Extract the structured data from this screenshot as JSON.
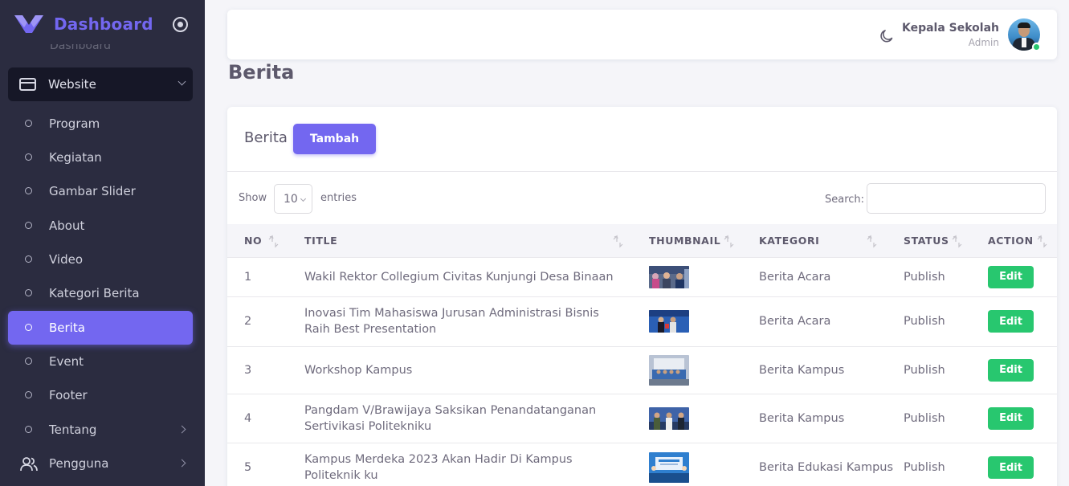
{
  "sidebar": {
    "brand": "Dashboard",
    "hidden_item": "Dashboard",
    "group": {
      "label": "Website"
    },
    "items": [
      {
        "label": "Program"
      },
      {
        "label": "Kegiatan"
      },
      {
        "label": "Gambar Slider"
      },
      {
        "label": "About"
      },
      {
        "label": "Video"
      },
      {
        "label": "Kategori Berita"
      },
      {
        "label": "Berita",
        "active": true
      },
      {
        "label": "Event"
      },
      {
        "label": "Footer"
      },
      {
        "label": "Tentang"
      },
      {
        "label": "Pengguna"
      }
    ]
  },
  "navbar": {
    "user_name": "Kepala Sekolah",
    "user_role": "Admin"
  },
  "page": {
    "title": "Berita"
  },
  "card": {
    "title": "Berita",
    "add_button": "Tambah",
    "show_label": "Show",
    "page_length": "10",
    "entries_label": "entries",
    "search_label": "Search:"
  },
  "table": {
    "headers": {
      "no": "NO",
      "title": "TITLE",
      "thumbnail": "THUMBNAIL",
      "kategori": "KATEGORI",
      "status": "STATUS",
      "action": "ACTION"
    },
    "rows": [
      {
        "no": "1",
        "title": "Wakil Rektor Collegium Civitas Kunjungi Desa Binaan",
        "kategori": "Berita Acara",
        "status": "Publish",
        "action": "Edit"
      },
      {
        "no": "2",
        "title": "Inovasi Tim Mahasiswa Jurusan Administrasi Bisnis Raih Best Presentation",
        "kategori": "Berita Acara",
        "status": "Publish",
        "action": "Edit"
      },
      {
        "no": "3",
        "title": "Workshop Kampus",
        "kategori": "Berita Kampus",
        "status": "Publish",
        "action": "Edit"
      },
      {
        "no": "4",
        "title": "Pangdam V/Brawijaya Saksikan Penandatanganan Sertivikasi Politekniku",
        "kategori": "Berita Kampus",
        "status": "Publish",
        "action": "Edit"
      },
      {
        "no": "5",
        "title": "Kampus Merdeka 2023 Akan Hadir Di Kampus Politeknik ku",
        "kategori": "Berita Edukasi Kampus",
        "status": "Publish",
        "action": "Edit"
      }
    ]
  },
  "colors": {
    "primary": "#7367f0",
    "success": "#28c76f",
    "sidebar_bg": "#2b2c40"
  }
}
